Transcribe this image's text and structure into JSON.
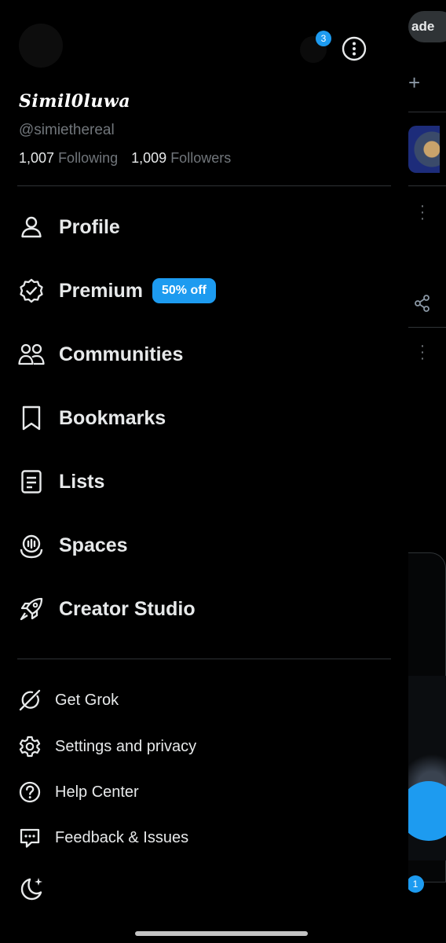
{
  "header": {
    "account_badge_count": "3",
    "display_name": "Simil0luwa",
    "handle": "@simiethereal",
    "following_count": "1,007",
    "following_label": "Following",
    "followers_count": "1,009",
    "followers_label": "Followers"
  },
  "nav": {
    "items": [
      {
        "label": "Profile",
        "icon": "person-icon"
      },
      {
        "label": "Premium",
        "icon": "verified-badge-icon",
        "promo": "50% off"
      },
      {
        "label": "Communities",
        "icon": "communities-icon"
      },
      {
        "label": "Bookmarks",
        "icon": "bookmark-icon"
      },
      {
        "label": "Lists",
        "icon": "list-icon"
      },
      {
        "label": "Spaces",
        "icon": "spaces-icon"
      },
      {
        "label": "Creator Studio",
        "icon": "rocket-icon"
      }
    ]
  },
  "secondary": {
    "items": [
      {
        "label": "Get Grok",
        "icon": "grok-icon"
      },
      {
        "label": "Settings and privacy",
        "icon": "gear-icon"
      },
      {
        "label": "Help Center",
        "icon": "help-icon"
      },
      {
        "label": "Feedback & Issues",
        "icon": "feedback-icon"
      }
    ]
  },
  "background": {
    "upgrade_label": "ade",
    "notification_count": "1"
  },
  "colors": {
    "accent": "#1d9bf0",
    "background": "#000000",
    "text": "#e7e9ea",
    "muted": "#71767b",
    "divider": "#2f3336"
  }
}
